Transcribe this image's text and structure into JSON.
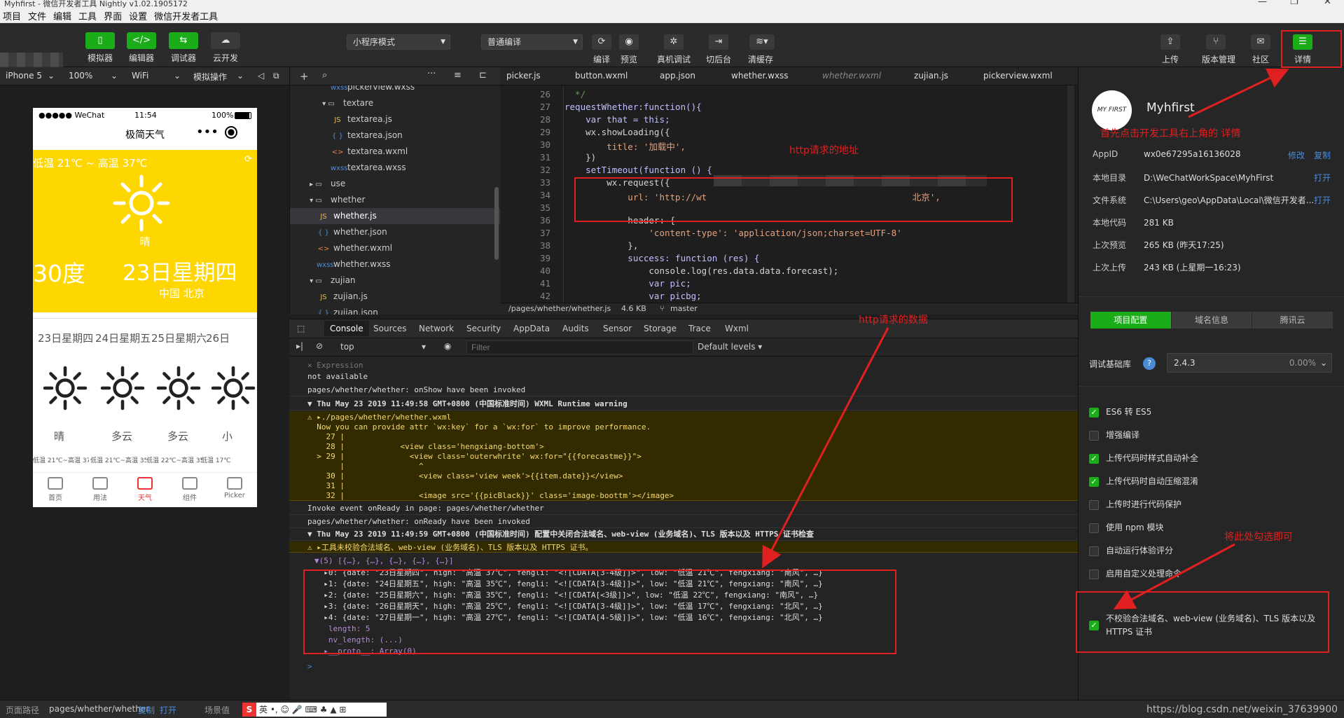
{
  "window": {
    "title": "Myhfirst - 微信开发者工具 Nightly v1.02.1905172"
  },
  "menu": [
    "项目",
    "文件",
    "编辑",
    "工具",
    "界面",
    "设置",
    "微信开发者工具"
  ],
  "toolbar": {
    "simulator": "模拟器",
    "editor": "编辑器",
    "debugger": "调试器",
    "cloud": "云开发",
    "mode_select": "小程序模式",
    "compile_select": "普通编译",
    "compile": "编译",
    "preview": "预览",
    "real_debug": "真机调试",
    "background": "切后台",
    "clear_cache": "清缓存",
    "upload": "上传",
    "version": "版本管理",
    "community": "社区",
    "details": "详情"
  },
  "simbar": {
    "device": "iPhone 5",
    "zoom": "100%",
    "network": "WiFi",
    "ops": "模拟操作"
  },
  "phone": {
    "status_carrier": "●●●●● WeChat",
    "status_time": "11:54",
    "status_battery": "100%",
    "nav_title": "极简天气",
    "temp_range": "低温 21℃ ~ 高温 37℃",
    "weather": "晴",
    "current_temp": "30度",
    "date_week": "23日星期四",
    "location": "中国 北京",
    "forecast": [
      {
        "date": "23日星期四",
        "weather": "晴",
        "range": "低温 21℃~高温 37℃"
      },
      {
        "date": "24日星期五",
        "weather": "多云",
        "range": "低温 21℃~高温 35℃"
      },
      {
        "date": "25日星期六",
        "weather": "多云",
        "range": "低温 22℃~高温 35℃"
      },
      {
        "date": "26日",
        "weather": "小",
        "range": "低温 17℃"
      }
    ],
    "tabs": [
      "首页",
      "用法",
      "天气",
      "组件",
      "Picker"
    ]
  },
  "tree": [
    {
      "name": "pickerview.wxss",
      "type": "wxss",
      "indent": 2
    },
    {
      "name": "textare",
      "type": "folder-open",
      "indent": 1
    },
    {
      "name": "textarea.js",
      "type": "js",
      "indent": 2
    },
    {
      "name": "textarea.json",
      "type": "json",
      "indent": 2
    },
    {
      "name": "textarea.wxml",
      "type": "wxml",
      "indent": 2
    },
    {
      "name": "textarea.wxss",
      "type": "wxss",
      "indent": 2
    },
    {
      "name": "use",
      "type": "folder",
      "indent": 0
    },
    {
      "name": "whether",
      "type": "folder-open",
      "indent": 0
    },
    {
      "name": "whether.js",
      "type": "js",
      "indent": 1,
      "selected": true
    },
    {
      "name": "whether.json",
      "type": "json",
      "indent": 1
    },
    {
      "name": "whether.wxml",
      "type": "wxml",
      "indent": 1
    },
    {
      "name": "whether.wxss",
      "type": "wxss",
      "indent": 1
    },
    {
      "name": "zujian",
      "type": "folder-open",
      "indent": 0
    },
    {
      "name": "zujian.js",
      "type": "js",
      "indent": 1
    },
    {
      "name": "zujian.json",
      "type": "json",
      "indent": 1
    }
  ],
  "editor_tabs": [
    {
      "name": "picker.js"
    },
    {
      "name": "button.wxml"
    },
    {
      "name": "app.json"
    },
    {
      "name": "whether.wxss"
    },
    {
      "name": "whether.wxml",
      "dim": true
    },
    {
      "name": "zujian.js"
    },
    {
      "name": "pickerview.wxml"
    }
  ],
  "code": [
    {
      "n": "26",
      "t": "  */"
    },
    {
      "n": "27",
      "t": "requestWhether:function(){"
    },
    {
      "n": "28",
      "t": "    var that = this;"
    },
    {
      "n": "29",
      "t": "    wx.showLoading({"
    },
    {
      "n": "30",
      "t": "        title: '加载中',"
    },
    {
      "n": "31",
      "t": "    })"
    },
    {
      "n": "32",
      "t": "    setTimeout(function () {"
    },
    {
      "n": "33",
      "t": "        wx.request({"
    },
    {
      "n": "34",
      "t": "            url: 'http://wt                                       北京',"
    },
    {
      "n": "35",
      "t": ""
    },
    {
      "n": "36",
      "t": "            header: {"
    },
    {
      "n": "37",
      "t": "                'content-type': 'application/json;charset=UTF-8'"
    },
    {
      "n": "38",
      "t": "            },"
    },
    {
      "n": "39",
      "t": "            success: function (res) {"
    },
    {
      "n": "40",
      "t": "                console.log(res.data.data.forecast);"
    },
    {
      "n": "41",
      "t": "                var pic;"
    },
    {
      "n": "42",
      "t": "                var picbg;"
    }
  ],
  "editor_status": {
    "path": "/pages/whether/whether.js",
    "size": "4.6 KB",
    "branch": "master"
  },
  "devtools_tabs": [
    "Console",
    "Sources",
    "Network",
    "Security",
    "AppData",
    "Audits",
    "Sensor",
    "Storage",
    "Trace",
    "Wxml"
  ],
  "filter": {
    "context": "top",
    "placeholder": "Filter",
    "levels": "Default levels ▾"
  },
  "console": [
    {
      "t": "× Expression",
      "cls": "plain dim"
    },
    {
      "t": "not available",
      "cls": "plain"
    },
    {
      "t": "pages/whether/whether: onShow have been invoked",
      "cls": ""
    },
    {
      "t": "▼ Thu May 23 2019 11:49:58 GMT+0800 (中国标准时间) WXML Runtime warning",
      "cls": "head"
    },
    {
      "t": "⚠ ▸./pages/whether/whether.wxml",
      "cls": "warn"
    },
    {
      "t": "  Now you can provide attr `wx:key` for a `wx:for` to improve performance.",
      "cls": "warn"
    },
    {
      "t": "    27 |",
      "cls": "warn"
    },
    {
      "t": "    28 |            <view class='hengxiang-bottom'>",
      "cls": "warn"
    },
    {
      "t": "  > 29 |              <view class='outerwhrite' wx:for=\"{{forecastme}}\">",
      "cls": "warn"
    },
    {
      "t": "       |                ^",
      "cls": "warn"
    },
    {
      "t": "    30 |                <view class='view_week'>{{item.date}}</view>",
      "cls": "warn"
    },
    {
      "t": "    31 |",
      "cls": "warn"
    },
    {
      "t": "    32 |                <image src='{{picBlack}}' class='image-boottm'></image>",
      "cls": "warn"
    },
    {
      "t": "Invoke event onReady in page: pages/whether/whether",
      "cls": ""
    },
    {
      "t": "pages/whether/whether: onReady have been invoked",
      "cls": ""
    },
    {
      "t": "▼ Thu May 23 2019 11:49:59 GMT+0800 (中国标准时间) 配置中关闭合法域名、web-view (业务域名)、TLS 版本以及 HTTPS 证书检查",
      "cls": "head"
    },
    {
      "t": "⚠ ▸工具未校验合法域名、web-view (业务域名)、TLS 版本以及 HTTPS 证书。",
      "cls": "warn"
    },
    {
      "t": "▼(5) [{…}, {…}, {…}, {…}, {…}]",
      "cls": "plain"
    },
    {
      "t": "  ▸0: {date: \"23日星期四\", high: \"高温 37℃\", fengli: \"<![CDATA[3-4级]]>\", low: \"低温 21℃\", fengxiang: \"南风\", …}",
      "cls": "plain"
    },
    {
      "t": "  ▸1: {date: \"24日星期五\", high: \"高温 35℃\", fengli: \"<![CDATA[3-4级]]>\", low: \"低温 21℃\", fengxiang: \"南风\", …}",
      "cls": "plain"
    },
    {
      "t": "  ▸2: {date: \"25日星期六\", high: \"高温 35℃\", fengli: \"<![CDATA[<3级]]>\", low: \"低温 22℃\", fengxiang: \"南风\", …}",
      "cls": "plain"
    },
    {
      "t": "  ▸3: {date: \"26日星期天\", high: \"高温 25℃\", fengli: \"<![CDATA[3-4级]]>\", low: \"低温 17℃\", fengxiang: \"北风\", …}",
      "cls": "plain"
    },
    {
      "t": "  ▸4: {date: \"27日星期一\", high: \"高温 27℃\", fengli: \"<![CDATA[4-5级]]>\", low: \"低温 16℃\", fengxiang: \"北风\", …}",
      "cls": "plain"
    },
    {
      "t": "   length: 5",
      "cls": "plain"
    },
    {
      "t": "   nv_length: (...)",
      "cls": "plain"
    },
    {
      "t": "  ▸__proto__: Array(0)",
      "cls": "plain"
    },
    {
      "t": ">",
      "cls": "plain"
    }
  ],
  "right": {
    "app_name": "Myhfirst",
    "logo_text": "MY FIRST",
    "rows": [
      {
        "k": "AppID",
        "v": "wx0e67295a16136028"
      },
      {
        "k": "本地目录",
        "v": "D:\\WeChatWorkSpace\\MyhFirst"
      },
      {
        "k": "文件系统",
        "v": "C:\\Users\\geo\\AppData\\Local\\微信开发者..."
      },
      {
        "k": "本地代码",
        "v": "281 KB"
      },
      {
        "k": "上次预览",
        "v": "265 KB (昨天17:25)"
      },
      {
        "k": "上次上传",
        "v": "243 KB (上星期一16:23)"
      }
    ],
    "links": {
      "edit": "修改",
      "copy": "复制",
      "open1": "打开",
      "open2": "打开"
    },
    "tabs": [
      "项目配置",
      "域名信息",
      "腾讯云"
    ],
    "lib_label": "调试基础库",
    "lib_version": "2.4.3",
    "lib_pct": "0.00%",
    "options": [
      {
        "label": "ES6 转 ES5",
        "on": true
      },
      {
        "label": "增强编译",
        "on": false
      },
      {
        "label": "上传代码时样式自动补全",
        "on": true
      },
      {
        "label": "上传代码时自动压缩混淆",
        "on": true
      },
      {
        "label": "上传时进行代码保护",
        "on": false
      },
      {
        "label": "使用 npm 模块",
        "on": false
      },
      {
        "label": "自动运行体验评分",
        "on": false
      },
      {
        "label": "启用自定义处理命令",
        "on": false
      }
    ],
    "domain_check": "不校验合法域名、web-view (业务域名)、TLS 版本以及 HTTPS 证书"
  },
  "bottom": {
    "path_label": "页面路径",
    "path": "pages/whether/whether",
    "copy": "复制",
    "open": "打开",
    "scene": "场景值",
    "watermark": "https://blog.csdn.net/weixin_37639900",
    "ime": "英"
  },
  "annotations": {
    "click_details": "首先点击开发工具右上角的   详情",
    "http_url": "http请求的地址",
    "http_data": "http请求的数据",
    "check_here": "将此处勾选即可"
  },
  "colors": {
    "accent": "#1aad19",
    "annotation": "#e02020",
    "weather_bg": "#ffd700"
  }
}
